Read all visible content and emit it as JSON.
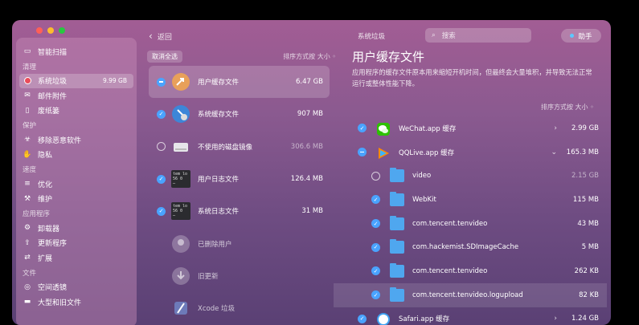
{
  "window": {
    "top_title": "系统垃圾",
    "back_label": "返回",
    "search_placeholder": "搜索",
    "helper_label": "助手"
  },
  "sidebar": {
    "items": [
      {
        "type": "item",
        "label": "智能扫描",
        "icon": "monitor-icon"
      },
      {
        "type": "section",
        "label": "清理"
      },
      {
        "type": "item",
        "label": "系统垃圾",
        "icon": "system-junk-icon",
        "size": "9.99 GB",
        "active": true
      },
      {
        "type": "item",
        "label": "邮件附件",
        "icon": "mail-icon"
      },
      {
        "type": "item",
        "label": "废纸篓",
        "icon": "trash-icon"
      },
      {
        "type": "section",
        "label": "保护"
      },
      {
        "type": "item",
        "label": "移除恶意软件",
        "icon": "biohazard-icon"
      },
      {
        "type": "item",
        "label": "隐私",
        "icon": "hand-icon"
      },
      {
        "type": "section",
        "label": "速度"
      },
      {
        "type": "item",
        "label": "优化",
        "icon": "sliders-icon"
      },
      {
        "type": "item",
        "label": "维护",
        "icon": "wrench-icon"
      },
      {
        "type": "section",
        "label": "应用程序"
      },
      {
        "type": "item",
        "label": "卸载器",
        "icon": "uninstaller-icon"
      },
      {
        "type": "item",
        "label": "更新程序",
        "icon": "updater-icon"
      },
      {
        "type": "item",
        "label": "扩展",
        "icon": "extensions-icon"
      },
      {
        "type": "section",
        "label": "文件"
      },
      {
        "type": "item",
        "label": "空间透镜",
        "icon": "lens-icon"
      },
      {
        "type": "item",
        "label": "大型和旧文件",
        "icon": "folder-icon"
      }
    ]
  },
  "middle": {
    "deselect_label": "取消全选",
    "sort_label": "排序方式按 大小 ◦",
    "rows": [
      {
        "name": "用户缓存文件",
        "size": "6.47 GB",
        "check": "partial",
        "selected": true,
        "icon": "user-cache-icon"
      },
      {
        "name": "系统缓存文件",
        "size": "907 MB",
        "check": "checked",
        "icon": "system-cache-icon"
      },
      {
        "name": "不使用的磁盘镜像",
        "size": "306.6 MB",
        "check": "empty",
        "icon": "disk-image-icon",
        "dim_size": true
      },
      {
        "name": "用户日志文件",
        "size": "126.4 MB",
        "check": "checked",
        "icon": "user-log-icon"
      },
      {
        "name": "系统日志文件",
        "size": "31 MB",
        "check": "checked",
        "icon": "system-log-icon"
      },
      {
        "name": "已删除用户",
        "size": "",
        "check": "none",
        "icon": "deleted-user-icon",
        "dim": true
      },
      {
        "name": "旧更新",
        "size": "",
        "check": "none",
        "icon": "old-updates-icon",
        "dim": true
      },
      {
        "name": "Xcode 垃圾",
        "size": "",
        "check": "none",
        "icon": "xcode-icon",
        "dim": true
      }
    ]
  },
  "right": {
    "title": "用户缓存文件",
    "description": "应用程序的缓存文件原本用来缩短开机时间，但最终会大量堆积，并导致无法正常运行或整体性能下降。",
    "sort_label": "排序方式按 大小 ◦",
    "rows": [
      {
        "name": "WeChat.app 缓存",
        "size": "2.99 GB",
        "check": "checked",
        "icon": "wechat-icon",
        "chevron": "›"
      },
      {
        "name": "QQLive.app 缓存",
        "size": "165.3 MB",
        "check": "partial",
        "icon": "qqlive-icon",
        "chevron": "⌄"
      },
      {
        "name": "video",
        "size": "2.15 GB",
        "check": "empty",
        "icon": "folder-icon",
        "indent": true,
        "dim_size": true
      },
      {
        "name": "WebKit",
        "size": "115 MB",
        "check": "checked",
        "icon": "folder-icon",
        "indent": true
      },
      {
        "name": "com.tencent.tenvideo",
        "size": "43 MB",
        "check": "checked",
        "icon": "folder-icon",
        "indent": true
      },
      {
        "name": "com.hackemist.SDImageCache",
        "size": "5 MB",
        "check": "checked",
        "icon": "folder-icon",
        "indent": true
      },
      {
        "name": "com.tencent.tenvideo",
        "size": "262 KB",
        "check": "checked",
        "icon": "folder-icon",
        "indent": true
      },
      {
        "name": "com.tencent.tenvideo.logupload",
        "size": "82 KB",
        "check": "checked",
        "icon": "folder-icon",
        "indent": true,
        "highlight": true
      },
      {
        "name": "Safari.app 缓存",
        "size": "1.24 GB",
        "check": "checked",
        "icon": "safari-icon",
        "chevron": "›"
      }
    ]
  },
  "colors": {
    "accent": "#4aa3ff",
    "danger": "#e94c5a",
    "folder": "#4fa7ef"
  }
}
